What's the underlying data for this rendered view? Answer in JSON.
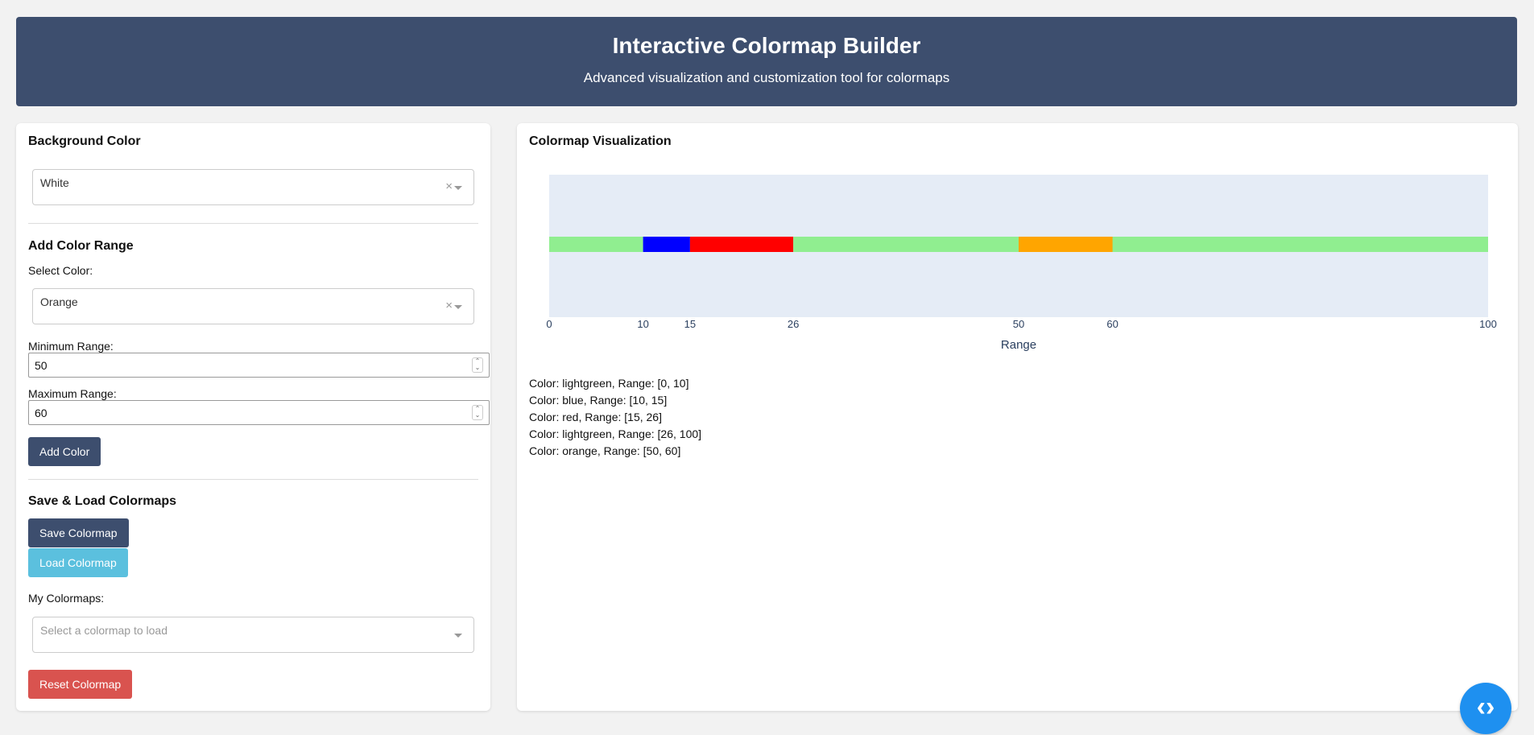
{
  "header": {
    "title": "Interactive Colormap Builder",
    "subtitle": "Advanced visualization and customization tool for colormaps"
  },
  "left_panel": {
    "background_color": {
      "title": "Background Color",
      "selected": "White"
    },
    "add_range": {
      "title": "Add Color Range",
      "select_color_label": "Select Color:",
      "selected_color": "Orange",
      "min_label": "Minimum Range:",
      "min_value": "50",
      "max_label": "Maximum Range:",
      "max_value": "60",
      "add_button": "Add Color"
    },
    "save_load": {
      "title": "Save & Load Colormaps",
      "save_button": "Save Colormap",
      "load_button": "Load Colormap",
      "my_colormaps_label": "My Colormaps:",
      "my_colormaps_placeholder": "Select a colormap to load",
      "reset_button": "Reset Colormap"
    }
  },
  "right_panel": {
    "title": "Colormap Visualization",
    "ranges_text": [
      "Color: lightgreen, Range: [0, 10]",
      "Color: blue, Range: [10, 15]",
      "Color: red, Range: [15, 26]",
      "Color: lightgreen, Range: [26, 100]",
      "Color: orange, Range: [50, 60]"
    ]
  },
  "chart_data": {
    "type": "bar",
    "xlabel": "Range",
    "xlim": [
      0,
      100
    ],
    "xticks": [
      0,
      10,
      15,
      26,
      50,
      60,
      100
    ],
    "grid": false,
    "segments": [
      {
        "color_name": "lightgreen",
        "color": "#90ee90",
        "start": 0,
        "end": 10
      },
      {
        "color_name": "blue",
        "color": "#0000ff",
        "start": 10,
        "end": 15
      },
      {
        "color_name": "red",
        "color": "#ff0000",
        "start": 15,
        "end": 26
      },
      {
        "color_name": "lightgreen",
        "color": "#90ee90",
        "start": 26,
        "end": 100
      },
      {
        "color_name": "orange",
        "color": "#ffa500",
        "start": 50,
        "end": 60
      }
    ]
  },
  "colors": {
    "header_bg": "#3d4e6e",
    "plot_bg": "#e5ecf6",
    "primary_button": "#3d4e6e",
    "info_button": "#5bc0de",
    "danger_button": "#d9534f",
    "fab": "#1e90f0"
  },
  "icons": {
    "clear": "×",
    "fab": "‹›"
  }
}
